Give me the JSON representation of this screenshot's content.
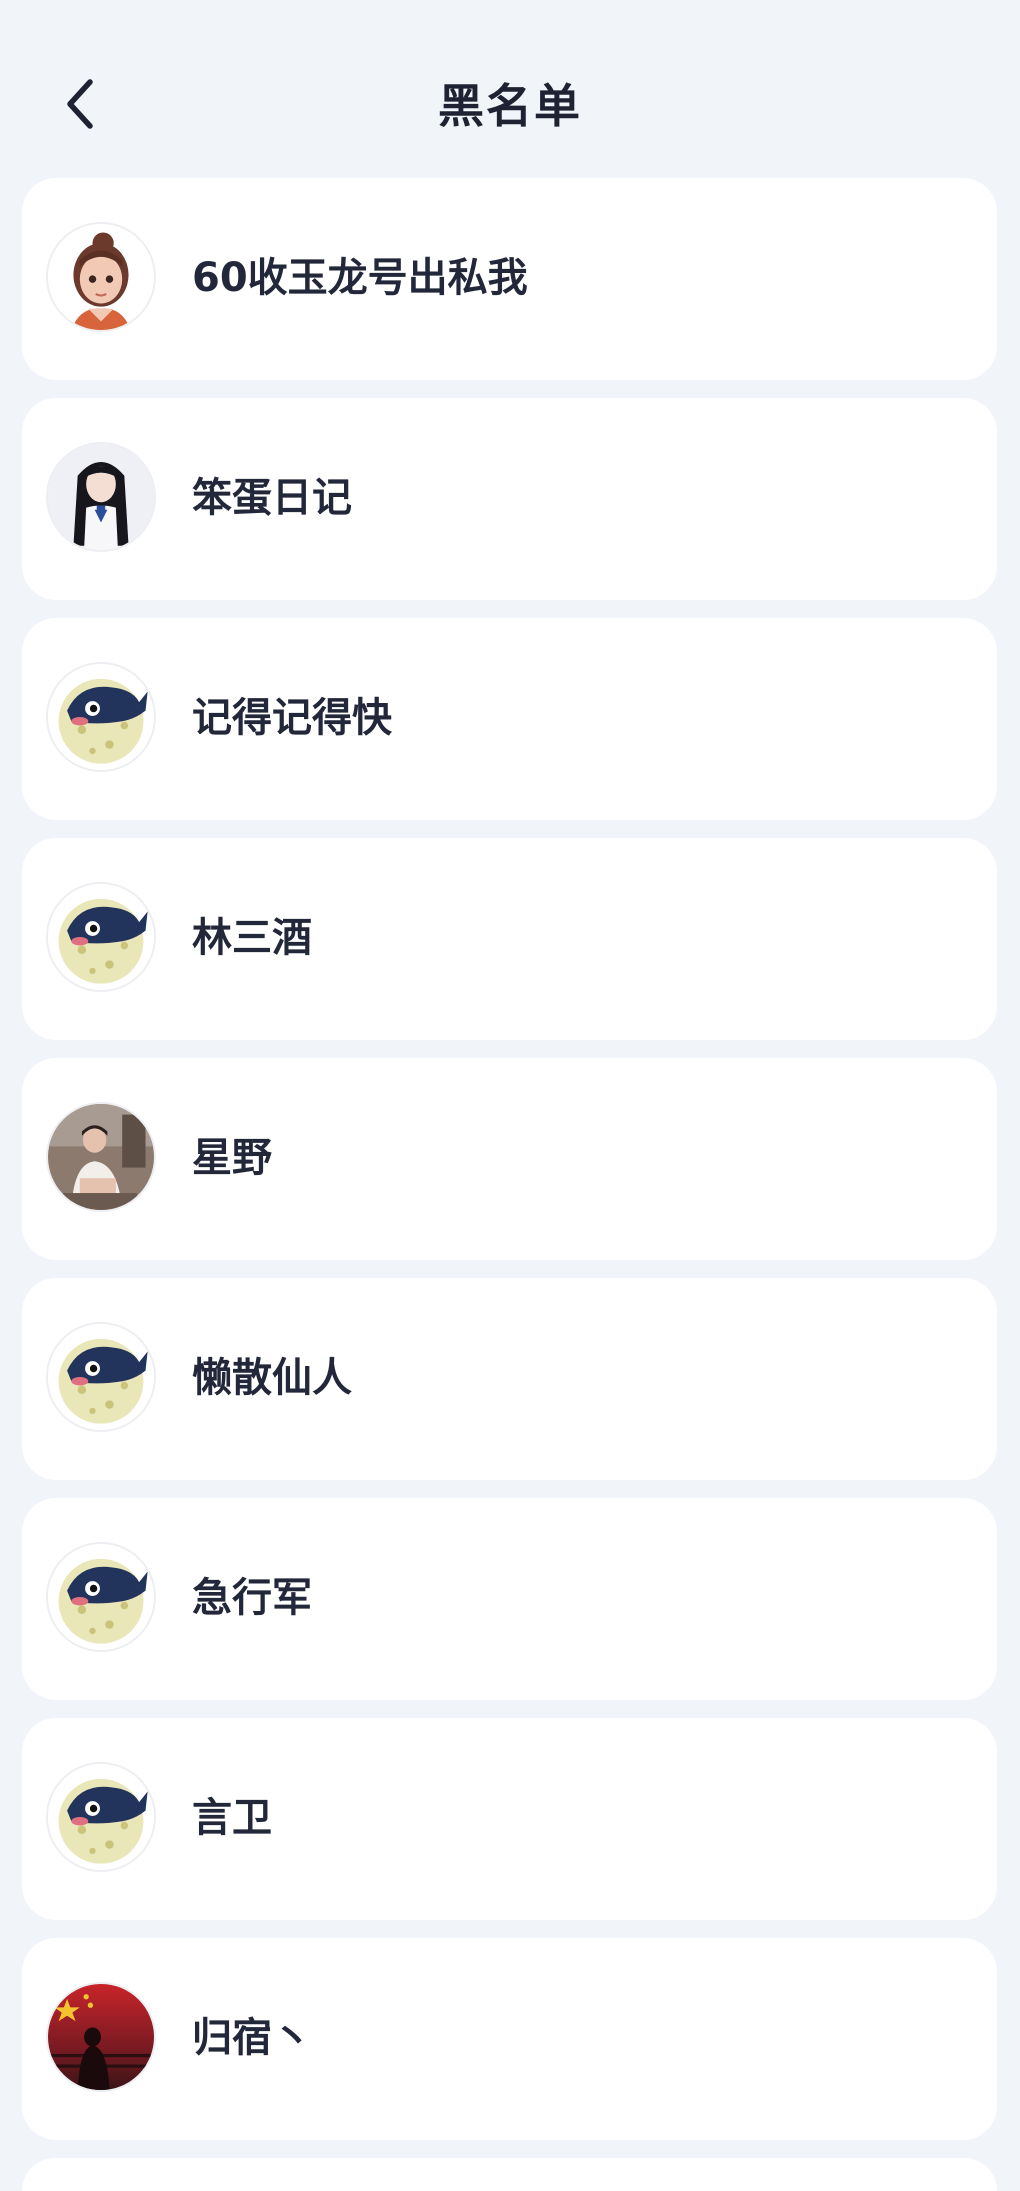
{
  "header": {
    "title": "黑名单",
    "back_icon": "chevron-left-icon"
  },
  "blocklist": [
    {
      "name": "60收玉龙号出私我",
      "avatar": "cartoon-girl-avatar"
    },
    {
      "name": "笨蛋日记",
      "avatar": "girl-photo-avatar"
    },
    {
      "name": "记得记得快",
      "avatar": "pufferfish-avatar"
    },
    {
      "name": "林三酒",
      "avatar": "pufferfish-avatar"
    },
    {
      "name": "星野",
      "avatar": "person-photo-avatar"
    },
    {
      "name": "懒散仙人",
      "avatar": "pufferfish-avatar"
    },
    {
      "name": "急行军",
      "avatar": "pufferfish-avatar"
    },
    {
      "name": "言卫",
      "avatar": "pufferfish-avatar"
    },
    {
      "name": "归宿丶",
      "avatar": "flag-sunset-avatar"
    }
  ],
  "colors": {
    "background": "#f1f4f8",
    "card": "#ffffff",
    "text": "#23273a"
  }
}
